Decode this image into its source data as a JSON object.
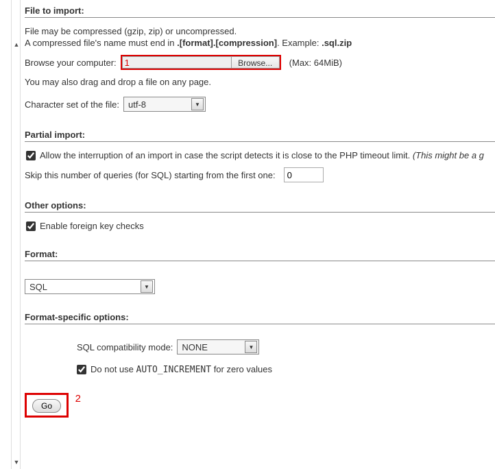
{
  "scroll": {
    "arrow_up": "▲",
    "arrow_down": "▼"
  },
  "file_to_import": {
    "heading": "File to import:",
    "compress_line1": "File may be compressed (gzip, zip) or uncompressed.",
    "compress_line2a": "A compressed file's name must end in ",
    "compress_line2_bold": ".[format].[compression]",
    "compress_line2b": ". Example: ",
    "compress_line2_example": ".sql.zip",
    "browse_label": "Browse your computer:",
    "annot_1": "1",
    "browse_btn": "Browse...",
    "max_size": "(Max: 64MiB)",
    "drag_line": "You may also drag and drop a file on any page.",
    "charset_label": "Character set of the file:",
    "charset_value": "utf-8"
  },
  "partial_import": {
    "heading": "Partial import:",
    "allow_interrupt_a": "Allow the interruption of an import in case the script detects it is close to the PHP timeout limit. ",
    "allow_interrupt_i": "(This might be a g",
    "skip_label": "Skip this number of queries (for SQL) starting from the first one:",
    "skip_value": "0"
  },
  "other_options": {
    "heading": "Other options:",
    "fk_label": "Enable foreign key checks"
  },
  "format": {
    "heading": "Format:",
    "value": "SQL"
  },
  "format_specific": {
    "heading": "Format-specific options:",
    "compat_label": "SQL compatibility mode:",
    "compat_value": "NONE",
    "no_auto_a": "Do not use ",
    "no_auto_code": "AUTO_INCREMENT",
    "no_auto_b": " for zero values"
  },
  "go": {
    "button_label": "Go",
    "annot_2": "2"
  },
  "select_arrow": "▼"
}
